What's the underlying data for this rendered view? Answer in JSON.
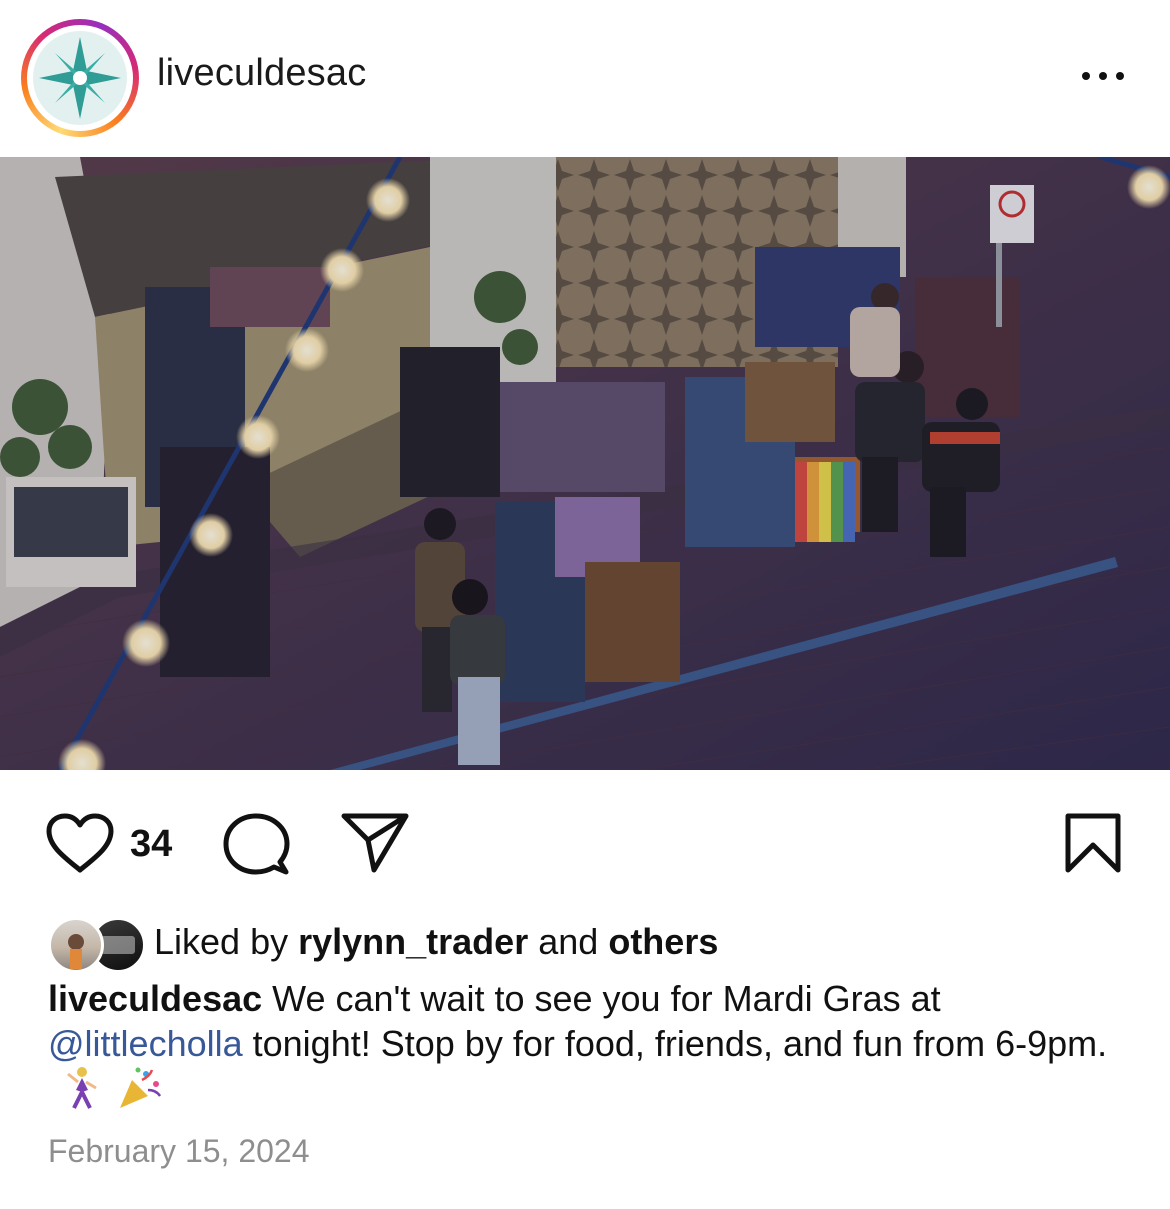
{
  "post": {
    "username": "liveculdesac",
    "avatar_icon": "compass-star-icon",
    "more_icon": "more-options-icon",
    "image_alt": "Overhead night photo of vintage clothing racks on a brick plaza under string lights"
  },
  "actions": {
    "like_icon": "heart-icon",
    "like_count": "34",
    "comment_icon": "comment-icon",
    "share_icon": "share-icon",
    "save_icon": "bookmark-icon"
  },
  "likes": {
    "prefix": "Liked by",
    "user": "rylynn_trader",
    "middle": "and",
    "others": "others"
  },
  "caption": {
    "username": "liveculdesac",
    "text_1": "We can't wait to see you for Mardi Gras at",
    "mention": "@littlecholla",
    "text_2": "tonight! Stop by for food, friends, and fun from 6-9pm.",
    "emoji_1": "dancer-emoji",
    "emoji_2": "party-popper-emoji"
  },
  "date": "February 15, 2024",
  "colors": {
    "accent_link": "#385898",
    "muted_text": "#8e8e8e",
    "brand_teal": "#2f9c95"
  }
}
